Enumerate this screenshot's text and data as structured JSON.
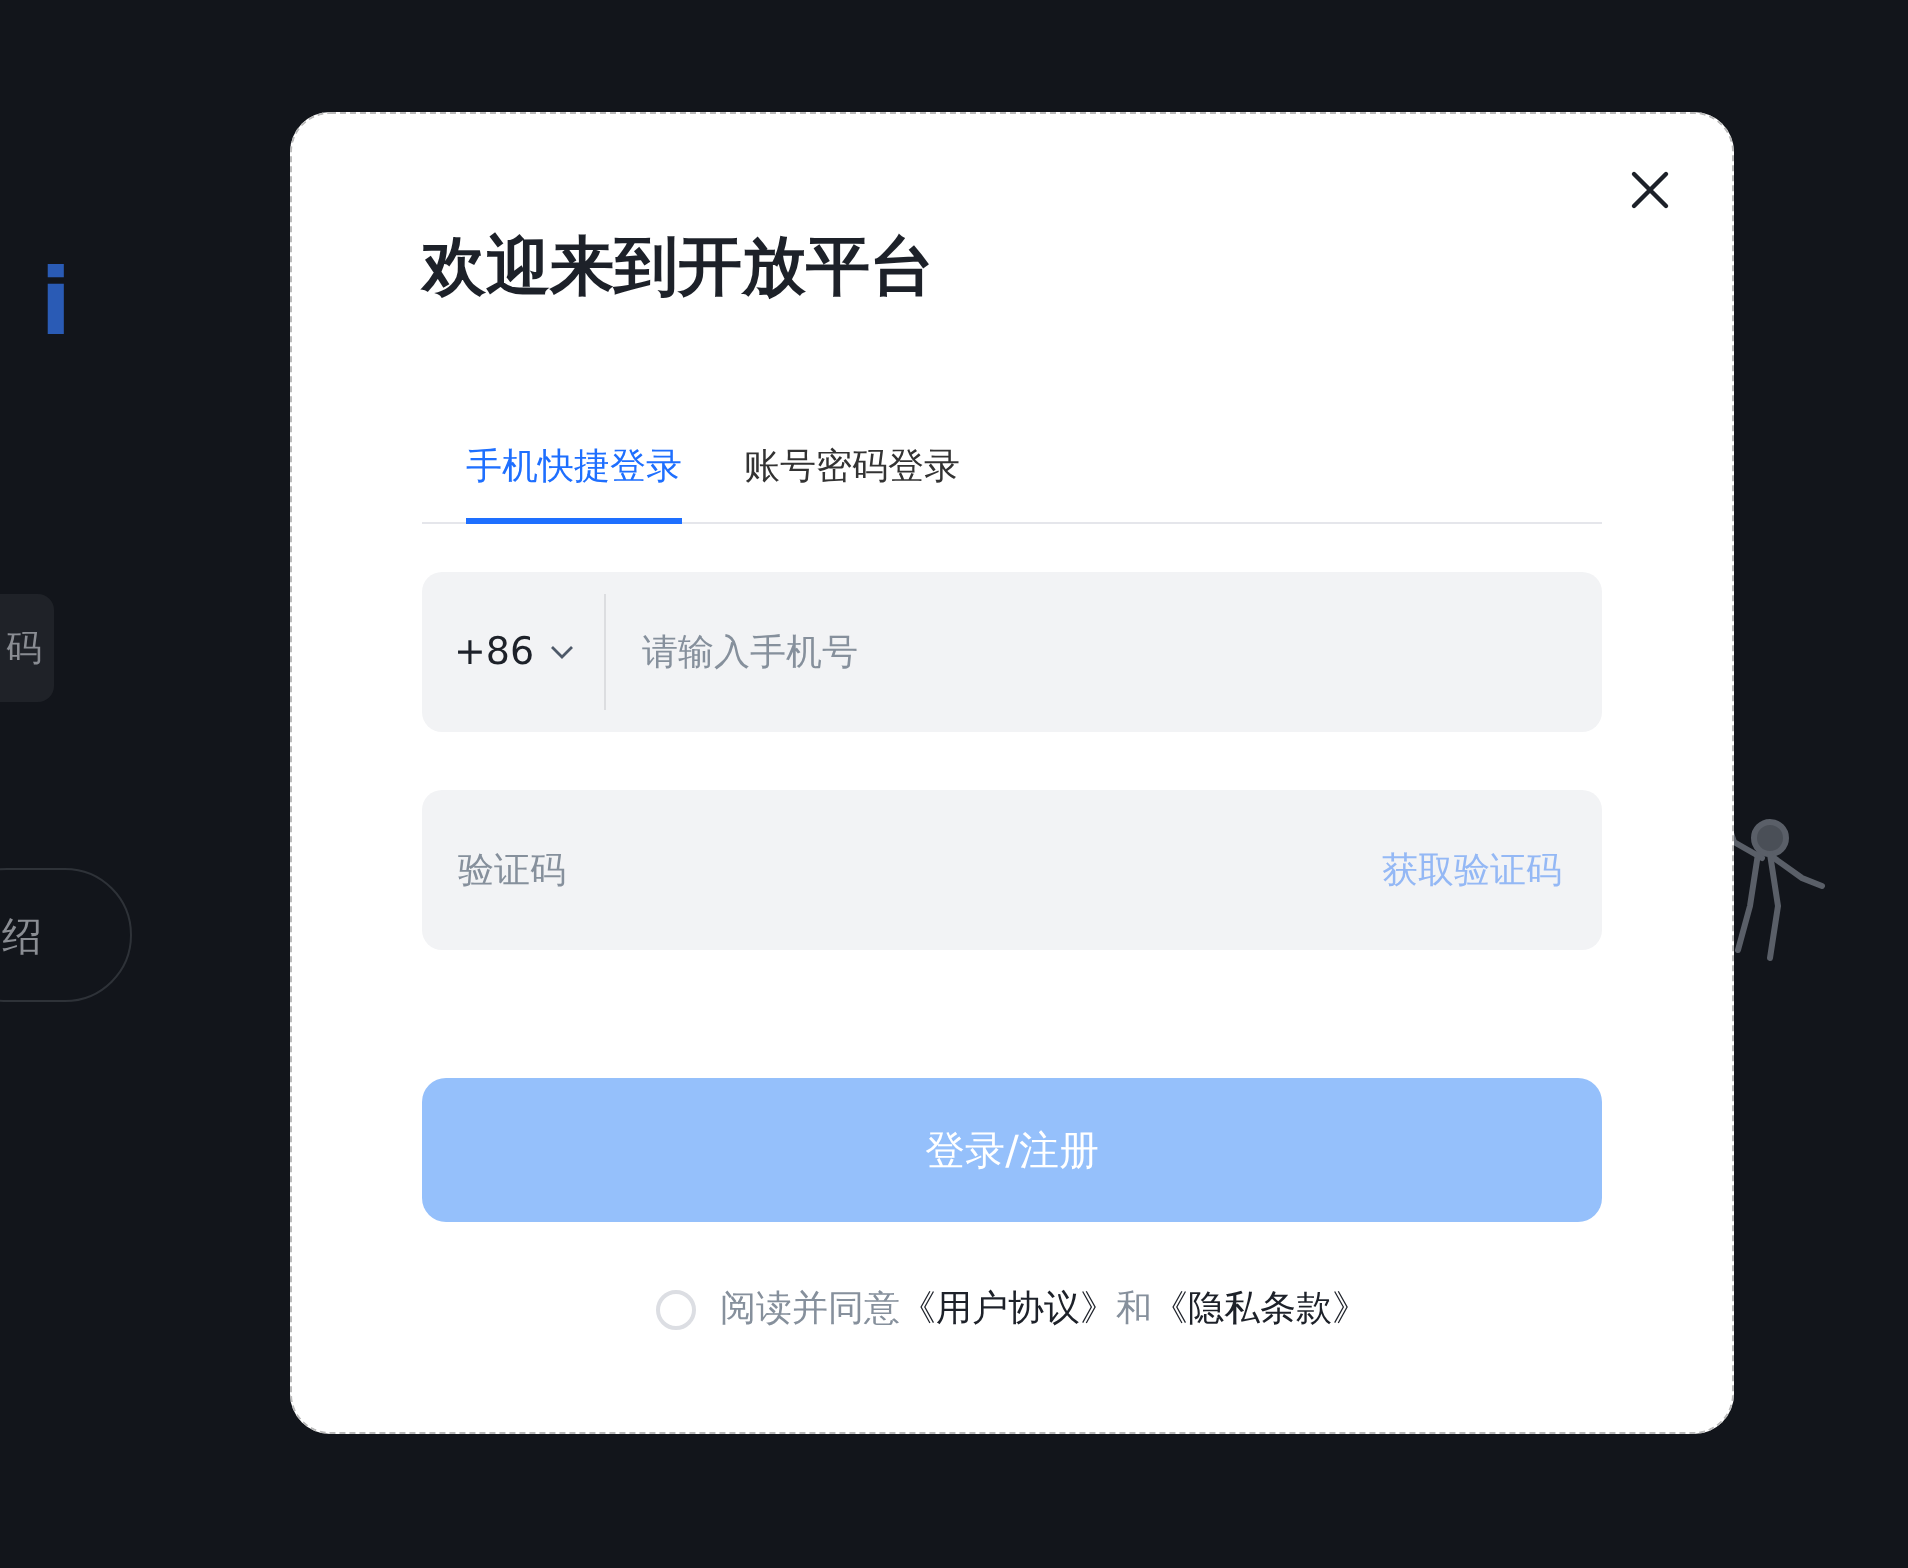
{
  "background": {
    "logo": "i",
    "button_1": "码",
    "button_2": "绍"
  },
  "dialog": {
    "title": "欢迎来到开放平台",
    "tabs": [
      {
        "label": "手机快捷登录",
        "selected": true
      },
      {
        "label": "账号密码登录",
        "selected": false
      }
    ],
    "phone": {
      "country_code": "+86",
      "placeholder": "请输入手机号"
    },
    "code": {
      "placeholder": "验证码",
      "action": "获取验证码"
    },
    "submit": {
      "label": "登录/注册",
      "disabled": true
    },
    "agreement": {
      "checked": false,
      "parts": [
        {
          "kind": "text",
          "text": "阅读并同意"
        },
        {
          "kind": "link",
          "text": "《用户协议》"
        },
        {
          "kind": "text",
          "text": "和"
        },
        {
          "kind": "link",
          "text": "《隐私条款》"
        }
      ]
    }
  }
}
